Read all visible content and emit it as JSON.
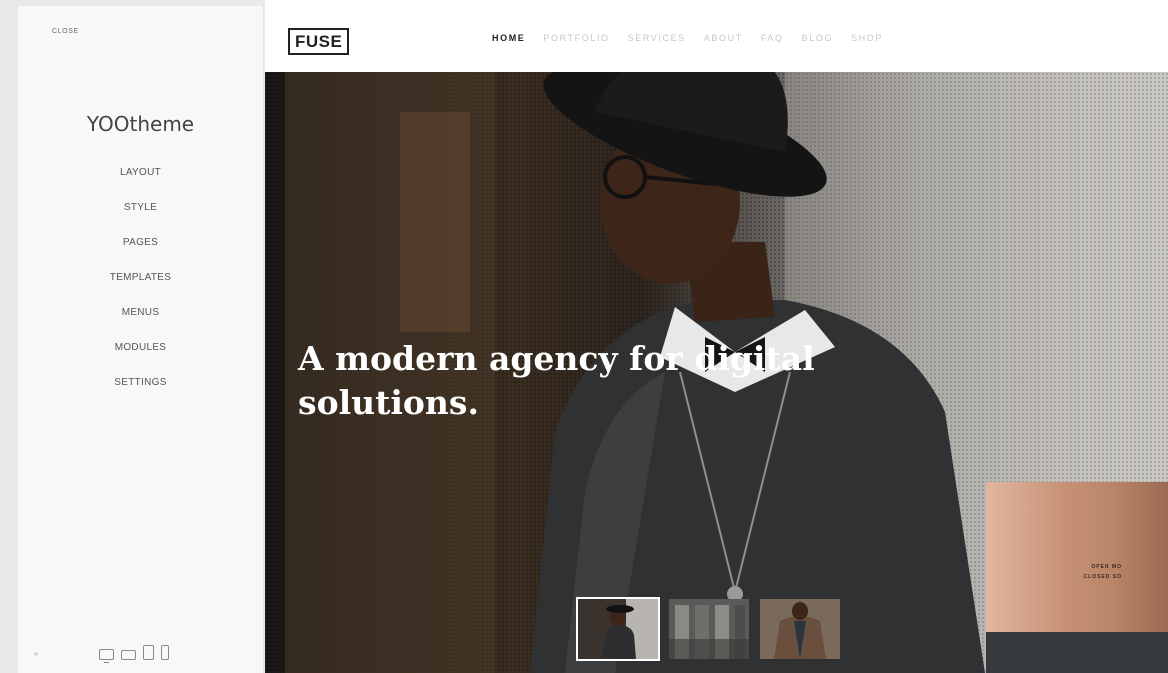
{
  "sidebar": {
    "close_label": "CLOSE",
    "title": "YOOtheme",
    "items": [
      {
        "label": "LAYOUT"
      },
      {
        "label": "STYLE"
      },
      {
        "label": "PAGES"
      },
      {
        "label": "TEMPLATES"
      },
      {
        "label": "MENUS"
      },
      {
        "label": "MODULES"
      },
      {
        "label": "SETTINGS"
      }
    ],
    "footer": {
      "collapse_icon": "double-chevron-left-icon",
      "devices": [
        "desktop-icon",
        "laptop-icon",
        "tablet-icon",
        "phone-icon"
      ]
    }
  },
  "header": {
    "logo": "FUSE",
    "nav": [
      {
        "label": "HOME",
        "active": true
      },
      {
        "label": "PORTFOLIO"
      },
      {
        "label": "SERVICES"
      },
      {
        "label": "ABOUT"
      },
      {
        "label": "FAQ"
      },
      {
        "label": "BLOG"
      },
      {
        "label": "SHOP"
      }
    ]
  },
  "hero": {
    "headline": "A modern agency for digital solutions.",
    "card_line_1": "OPEN MO",
    "card_line_2": "CLOSED SO",
    "thumbnails": [
      "thumbnail-portrait",
      "thumbnail-office",
      "thumbnail-coat"
    ]
  },
  "colors": {
    "sidebar_bg": "#f8f8f8",
    "header_bg": "#ffffff",
    "nav_active": "#222222",
    "nav_inactive": "#c8c8c8",
    "headline": "#ffffff",
    "card_copper": "#c69073"
  }
}
